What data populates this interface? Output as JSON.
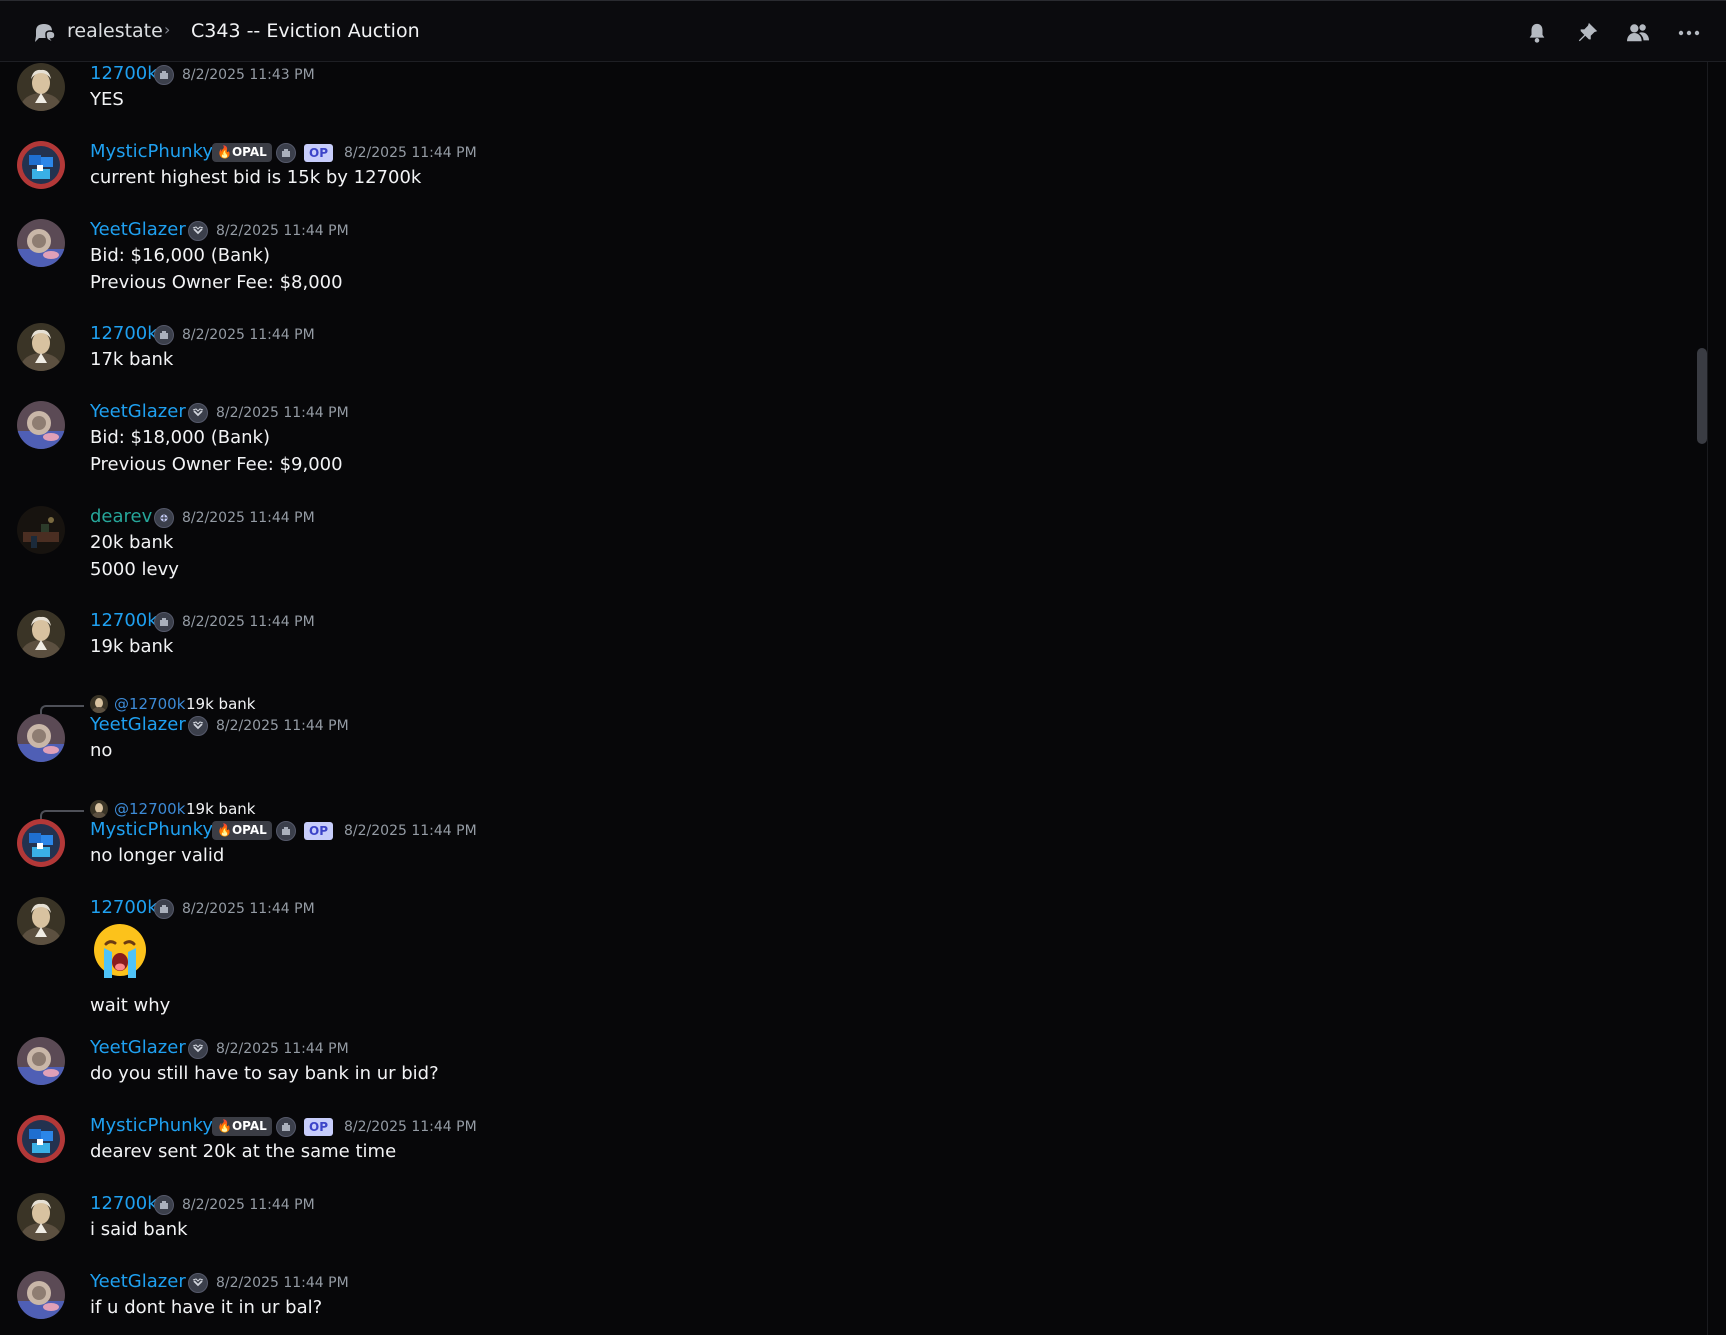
{
  "header": {
    "server_name": "realestate",
    "separator": "›",
    "thread_title": "C343 -- Eviction Auction",
    "tools": [
      "bell-icon",
      "pin-icon",
      "members-icon",
      "more-icon"
    ]
  },
  "tags": {
    "opal": "OPAL",
    "op": "OP"
  },
  "messages": [
    {
      "author": "12700k",
      "timestamp": "8/2/2025 11:43 PM",
      "lines": [
        "YES"
      ]
    },
    {
      "author": "MysticPhunky",
      "timestamp": "8/2/2025 11:44 PM",
      "lines": [
        "current highest bid is 15k by 12700k"
      ]
    },
    {
      "author": "YeetGlazer",
      "timestamp": "8/2/2025 11:44 PM",
      "lines": [
        "Bid: $16,000 (Bank)",
        "Previous Owner Fee: $8,000"
      ]
    },
    {
      "author": "12700k",
      "timestamp": "8/2/2025 11:44 PM",
      "lines": [
        "17k bank"
      ]
    },
    {
      "author": "YeetGlazer",
      "timestamp": "8/2/2025 11:44 PM",
      "lines": [
        "Bid: $18,000 (Bank)",
        "Previous Owner Fee: $9,000"
      ]
    },
    {
      "author": "dearev",
      "timestamp": "8/2/2025 11:44 PM",
      "lines": [
        "20k bank",
        "5000 levy"
      ]
    },
    {
      "author": "12700k",
      "timestamp": "8/2/2025 11:44 PM",
      "lines": [
        "19k bank"
      ]
    },
    {
      "author": "YeetGlazer",
      "timestamp": "8/2/2025 11:44 PM",
      "reply_to": "@12700k",
      "reply_text": "19k bank",
      "lines": [
        "no"
      ]
    },
    {
      "author": "MysticPhunky",
      "timestamp": "8/2/2025 11:44 PM",
      "reply_to": "@12700k",
      "reply_text": "19k bank",
      "lines": [
        "no longer valid"
      ]
    },
    {
      "author": "12700k",
      "timestamp": "8/2/2025 11:44 PM",
      "emoji": "loudly-crying-face",
      "lines": [
        "wait why"
      ]
    },
    {
      "author": "YeetGlazer",
      "timestamp": "8/2/2025 11:44 PM",
      "lines": [
        "do you still have to say bank in ur bid?"
      ]
    },
    {
      "author": "MysticPhunky",
      "timestamp": "8/2/2025 11:44 PM",
      "lines": [
        "dearev sent 20k at the same time"
      ]
    },
    {
      "author": "12700k",
      "timestamp": "8/2/2025 11:44 PM",
      "lines": [
        "i said bank"
      ]
    },
    {
      "author": "YeetGlazer",
      "timestamp": "8/2/2025 11:44 PM",
      "lines": [
        "if u dont have it in ur bal?"
      ]
    }
  ],
  "colors": {
    "background": "#070709",
    "username_blue": "#1fa0f0",
    "username_teal": "#26a69a",
    "timestamp": "#949ba4",
    "text": "#f2f3f5"
  }
}
